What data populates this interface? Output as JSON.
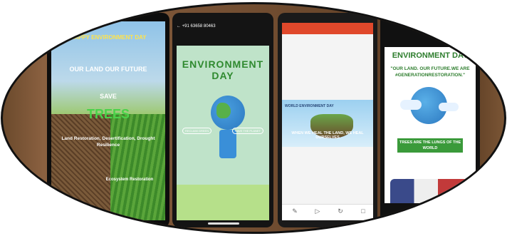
{
  "phones": [
    {
      "line1": "HAPPY ENVIRONMENT DAY",
      "line2": "OUR LAND OUR FUTURE",
      "line3": "SAVE",
      "line4": "TREES",
      "line5": "Land Restoration, Desertification, Drought Resilience",
      "line6": "Ecosystem Restoration"
    },
    {
      "status": "+91 63658 80463",
      "title": "ENVIRONMENT DAY",
      "pill_left": "RECLAIM GREEN",
      "pill_right": "SAVE THE PLANET"
    },
    {
      "slide_label": "WORLD ENVIRONMENT DAY",
      "slide_text": "WHEN WE HEAL THE LAND, WE HEAL OURSELVES"
    },
    {
      "title": "ENVIRONMENT DAY",
      "subtitle": "\"OUR LAND. OUR FUTURE.WE ARE #GENERATIONRESTORATION.\"",
      "banner": "TREES ARE THE LUNGS OF THE WORLD"
    }
  ],
  "colors": {
    "frame": "#1a1a1a",
    "accent_green": "#2d7d2d",
    "accent_red": "#e0482b"
  }
}
